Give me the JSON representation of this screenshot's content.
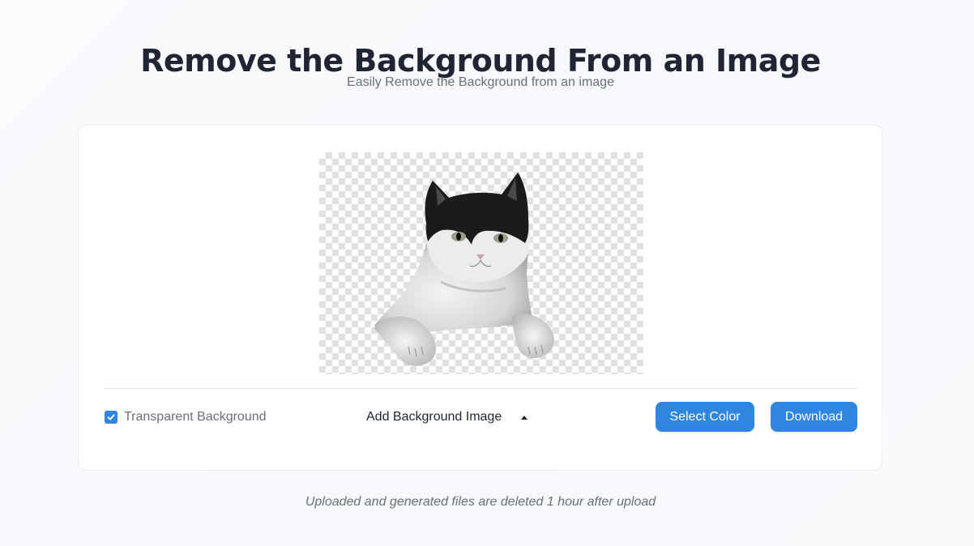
{
  "header": {
    "title": "Remove the Background From an Image",
    "subtitle": "Easily Remove the Background from an image"
  },
  "preview": {
    "subject": "cat-cutout",
    "background": "transparent-checkerboard"
  },
  "controls": {
    "transparent_label": "Transparent Background",
    "transparent_checked": true,
    "background_image_label": "Add Background Image",
    "select_color_label": "Select Color",
    "download_label": "Download"
  },
  "footer": {
    "note": "Uploaded and generated files are deleted 1 hour after upload"
  },
  "colors": {
    "accent": "#2f86de",
    "title": "#1f2533",
    "muted": "#6b6f78"
  }
}
